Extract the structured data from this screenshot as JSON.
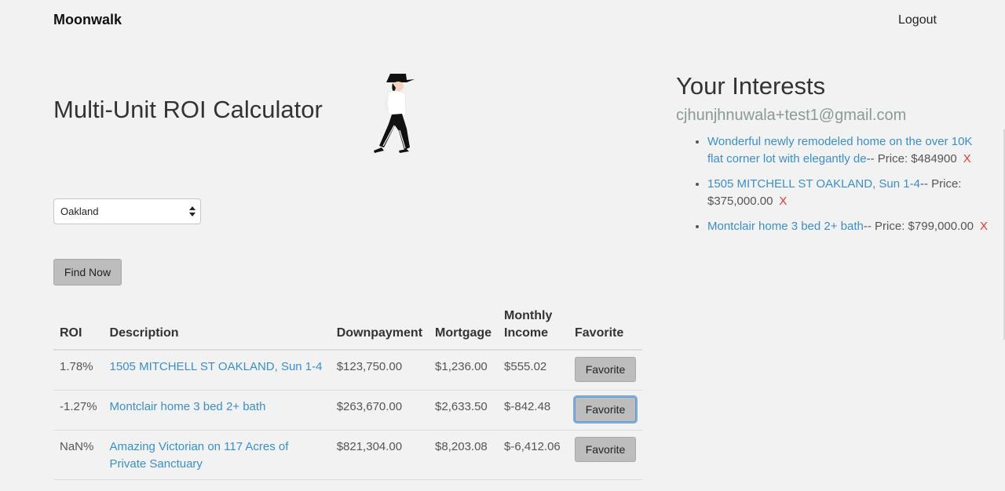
{
  "nav": {
    "brand": "Moonwalk",
    "logout_label": "Logout"
  },
  "main": {
    "title": "Multi-Unit ROI Calculator",
    "city_select": {
      "selected": "Oakland"
    },
    "find_button_label": "Find Now",
    "table": {
      "headers": {
        "roi": "ROI",
        "description": "Description",
        "downpayment": "Downpayment",
        "mortgage": "Mortgage",
        "monthly_income_line1": "Monthly",
        "monthly_income_line2": "Income",
        "favorite": "Favorite"
      },
      "rows": [
        {
          "roi": "1.78%",
          "description": "1505 MITCHELL ST OAKLAND, Sun 1-4",
          "downpayment": "$123,750.00",
          "mortgage": "$1,236.00",
          "monthly_income": "$555.02",
          "favorite_label": "Favorite"
        },
        {
          "roi": "-1.27%",
          "description": "Montclair home 3 bed 2+ bath",
          "downpayment": "$263,670.00",
          "mortgage": "$2,633.50",
          "monthly_income": "$-842.48",
          "favorite_label": "Favorite"
        },
        {
          "roi": "NaN%",
          "description": "Amazing Victorian on 117 Acres of Private Sanctuary",
          "downpayment": "$821,304.00",
          "mortgage": "$8,203.08",
          "monthly_income": "$-6,412.06",
          "favorite_label": "Favorite"
        }
      ]
    }
  },
  "sidebar": {
    "title": "Your Interests",
    "email": "cjhunjhnuwala+test1@gmail.com",
    "items": [
      {
        "link": "Wonderful newly remodeled home on the over 10K flat corner lot with elegantly de",
        "price_text": "-- Price: $484900",
        "remove": "X"
      },
      {
        "link": "1505 MITCHELL ST OAKLAND, Sun 1-4",
        "price_text": "-- Price: $375,000.00",
        "remove": "X"
      },
      {
        "link": "Montclair home 3 bed 2+ bath",
        "price_text": "-- Price: $799,000.00",
        "remove": "X"
      }
    ]
  },
  "colors": {
    "link": "#3a8fc9",
    "remove": "#e03a3a",
    "button": "#bdbdbd",
    "email": "#8a9a94"
  },
  "icons": {
    "mascot": "moonwalk-dancer-illustration",
    "select_arrows": "select-arrows-icon"
  }
}
